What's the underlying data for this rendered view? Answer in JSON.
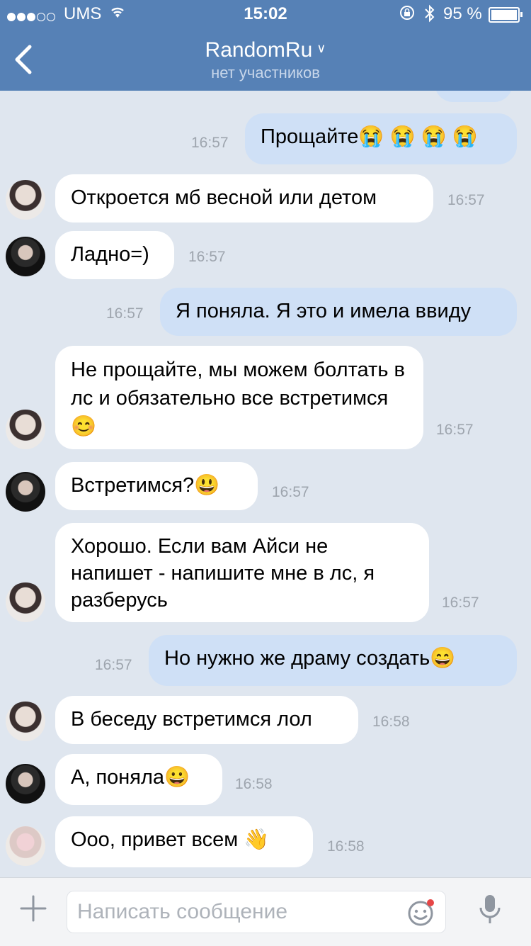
{
  "status_bar": {
    "carrier": "UMS",
    "time": "15:02",
    "battery_percent": "95 %"
  },
  "header": {
    "title": "RandomRu",
    "subtitle": "нет участников"
  },
  "messages": [
    {
      "text": "Прощайте😭 😭 😭 😭",
      "time": "16:57"
    },
    {
      "text": "Откроется мб весной или детом",
      "time": "16:57"
    },
    {
      "text": "Ладно=)",
      "time": "16:57"
    },
    {
      "text": "Я поняла. Я это и имела ввиду",
      "time": "16:57"
    },
    {
      "text": "Не прощайте, мы можем болтать в лс и обязательно все встретимся 😊",
      "time": "16:57"
    },
    {
      "text": "Встретимся?😃",
      "time": "16:57"
    },
    {
      "text": "Хорошо. Если вам Айси не напишет - напишите мне в лс, я разберусь",
      "time": "16:57"
    },
    {
      "text": "Но нужно же драму создать😄",
      "time": "16:57"
    },
    {
      "text": "В беседу встретимся лол",
      "time": "16:58"
    },
    {
      "text": "А, поняла😀",
      "time": "16:58"
    },
    {
      "text": "Ооо, привет всем 👋",
      "time": "16:58"
    }
  ],
  "composer": {
    "placeholder": "Написать сообщение"
  },
  "icons": {
    "back": "chevron-left-icon",
    "attach": "plus-icon",
    "emoji": "smile-icon",
    "voice": "microphone-icon"
  },
  "colors": {
    "header": "#5681b6",
    "background": "#dfe6ef",
    "incoming_bubble": "#ffffff",
    "outgoing_bubble": "#cfe0f6",
    "notification_dot": "#e64646"
  }
}
